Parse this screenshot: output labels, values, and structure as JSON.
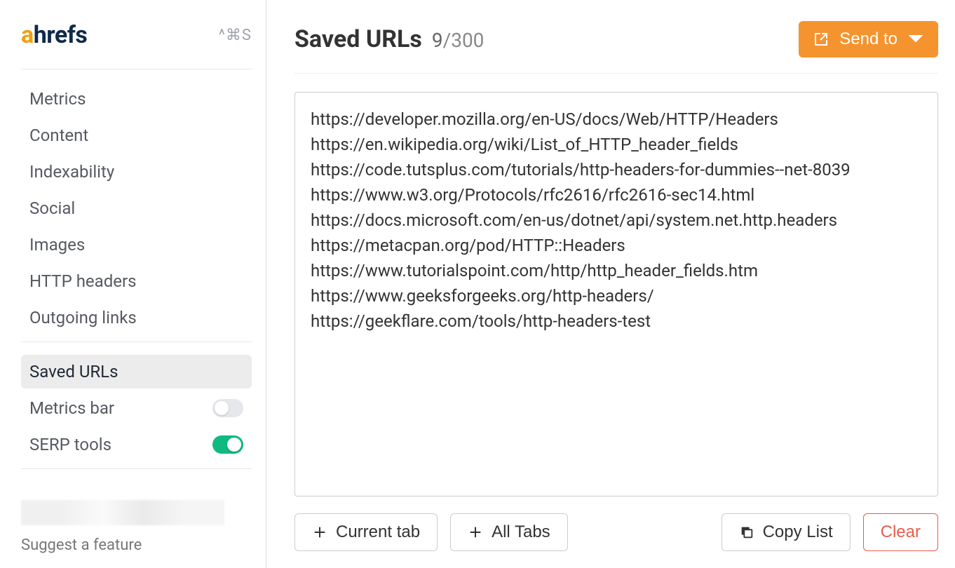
{
  "brand": {
    "a": "a",
    "rest": "hrefs"
  },
  "shortcut": "^⌘S",
  "sidebar": {
    "items": [
      {
        "label": "Metrics"
      },
      {
        "label": "Content"
      },
      {
        "label": "Indexability"
      },
      {
        "label": "Social"
      },
      {
        "label": "Images"
      },
      {
        "label": "HTTP headers"
      },
      {
        "label": "Outgoing links"
      }
    ],
    "secondary": [
      {
        "label": "Saved URLs",
        "selected": true
      },
      {
        "label": "Metrics bar",
        "toggle": false
      },
      {
        "label": "SERP tools",
        "toggle": true
      }
    ],
    "suggest": "Suggest a feature"
  },
  "main": {
    "title": "Saved URLs",
    "count_current": "9",
    "count_separator": "/",
    "count_total": "300",
    "send_to": "Send to",
    "urls": "https://developer.mozilla.org/en-US/docs/Web/HTTP/Headers\nhttps://en.wikipedia.org/wiki/List_of_HTTP_header_fields\nhttps://code.tutsplus.com/tutorials/http-headers-for-dummies--net-8039\nhttps://www.w3.org/Protocols/rfc2616/rfc2616-sec14.html\nhttps://docs.microsoft.com/en-us/dotnet/api/system.net.http.headers\nhttps://metacpan.org/pod/HTTP::Headers\nhttps://www.tutorialspoint.com/http/http_header_fields.htm\nhttps://www.geeksforgeeks.org/http-headers/\nhttps://geekflare.com/tools/http-headers-test",
    "buttons": {
      "current_tab": "Current tab",
      "all_tabs": "All Tabs",
      "copy_list": "Copy List",
      "clear": "Clear"
    }
  }
}
